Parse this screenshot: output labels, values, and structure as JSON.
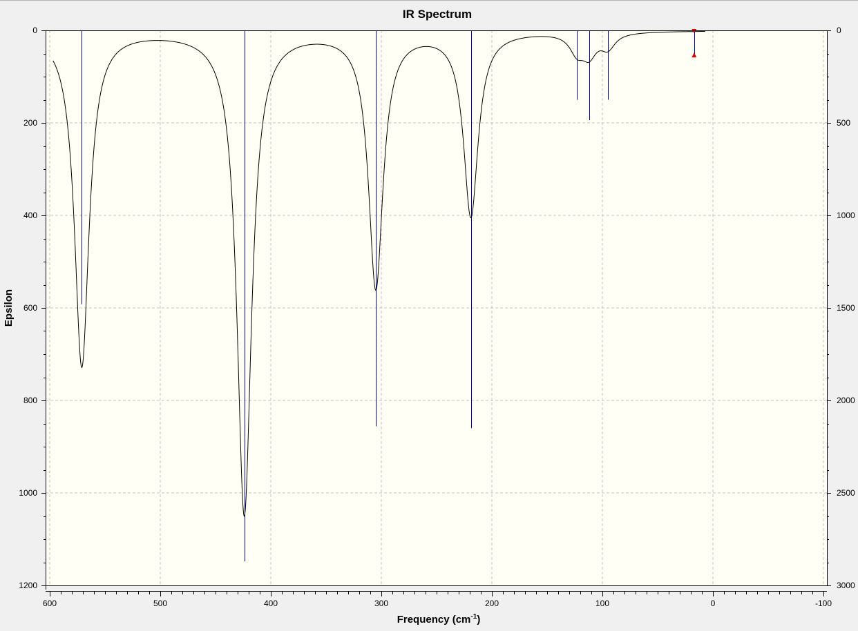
{
  "chart_data": {
    "type": "line",
    "title": "IR Spectrum",
    "xlabel": "Frequency",
    "xlabel_unit_prefix": "(cm",
    "xlabel_unit_exp": "-1",
    "xlabel_unit_suffix": ")",
    "ylabel": "Epsilon",
    "xlim": [
      600,
      -100
    ],
    "ylim": [
      0,
      1200
    ],
    "y2lim": [
      0,
      3000
    ],
    "y_inverted": true,
    "grid": true,
    "x_ticks": [
      600,
      500,
      400,
      300,
      200,
      100,
      0,
      -100
    ],
    "x_tick_labels": [
      "600",
      "500",
      "400",
      "300",
      "200",
      "100",
      "0",
      "-100"
    ],
    "y_ticks": [
      0,
      200,
      400,
      600,
      800,
      1000,
      1200
    ],
    "y_tick_labels": [
      "0",
      "200",
      "400",
      "600",
      "800",
      "1000",
      "1200"
    ],
    "y2_ticks": [
      0,
      500,
      1000,
      1500,
      2000,
      2500,
      3000
    ],
    "y2_tick_labels": [
      "0",
      "500",
      "1000",
      "1500",
      "2000",
      "2500",
      "3000"
    ],
    "spectrum_peaks": [
      {
        "x": 571,
        "y": 725
      },
      {
        "x": 424,
        "y": 1045
      },
      {
        "x": 305,
        "y": 553
      },
      {
        "x": 219,
        "y": 398
      },
      {
        "x": 123,
        "y": 40
      },
      {
        "x": 112,
        "y": 45
      },
      {
        "x": 95,
        "y": 32
      }
    ],
    "spectrum_range": [
      597,
      7
    ],
    "stick_spectrum": [
      {
        "frequency": 571,
        "intensity": 1480
      },
      {
        "frequency": 424,
        "intensity": 2870
      },
      {
        "frequency": 305,
        "intensity": 2140
      },
      {
        "frequency": 219,
        "intensity": 2150
      },
      {
        "frequency": 123,
        "intensity": 375
      },
      {
        "frequency": 112,
        "intensity": 485
      },
      {
        "frequency": 95,
        "intensity": 375
      },
      {
        "frequency": 17,
        "intensity": 135
      }
    ],
    "colors": {
      "plot_background": "#fffff5",
      "spectrum_line": "#000000",
      "stick_line": "#00008b",
      "grid": "#c2c2c2",
      "marker": "#e00000"
    }
  }
}
